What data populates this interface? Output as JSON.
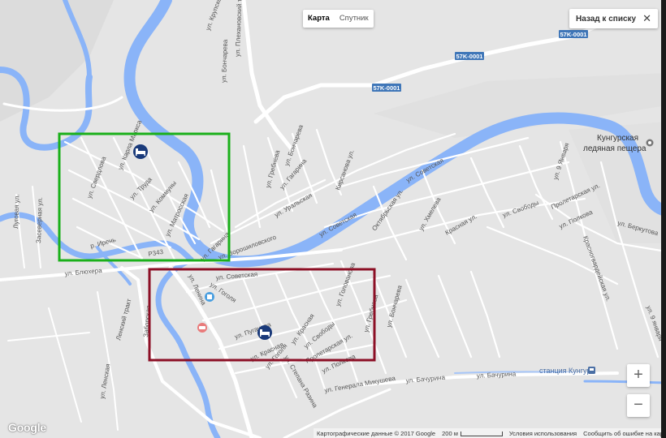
{
  "map_type": {
    "map": "Карта",
    "satellite": "Спутник"
  },
  "back_button": {
    "label": "Назад к списку",
    "close": "✕"
  },
  "zoom": {
    "in": "+",
    "out": "−"
  },
  "logo": "Google",
  "footer": {
    "copyright": "Картографические данные © 2017 Google",
    "scale": "200 м",
    "terms": "Условия использования",
    "report": "Сообщить об ошибке на карте"
  },
  "highways": [
    "57K-0001",
    "57K-0001",
    "57K-0001"
  ],
  "places": {
    "cave_line1": "Кунгурская",
    "cave_line2": "ледяная пещера",
    "station": "станция Кунгур"
  },
  "streets": {
    "krupskaya": "ул. Крупской",
    "plekhanov": "ул. Плехановский тракт",
    "bonchareva_top": "ул. Бончарева",
    "karl_marx": "ул. Карла Маркса",
    "sverdlova": "ул. Свердлова",
    "truda": "ул. Труда",
    "kommuny": "ул. Коммуны",
    "matrosskaya": "ул. Матросская",
    "gagarina_left": "ул. Гагарина",
    "gagarina_mid": "ул. Гагарина",
    "grebneva": "ул. Гребнева",
    "bonchareva_mid": "ул. Бончарева",
    "kirsanova": "Кирсанова ул.",
    "uralskaya": "ул. Уральская",
    "sovetskaya_top": "ул. Советская",
    "sovetskaya_mid": "ул. Советская",
    "sovetskaya_bottom": "ул. Советская",
    "voroshilovsky": "ул. Ворошиловского",
    "oktyabrskaya": "Октябрьская ул.",
    "khmeleva": "ул. Хмелева",
    "krasnaya_right": "Красная ул.",
    "svobody_right": "ул. Свободы",
    "proletarskaya_right": "Пролетарская ул.",
    "polkova": "ул. Полкова",
    "yanvarya_9_top": "ул. 9 Января",
    "yanvarya_9_bottom": "ул. 9 января",
    "berkutova": "ул. Беркутова",
    "krasnogvardeyskaya": "Красногвардейская ул.",
    "lugovaya": "Луговая ул.",
    "zaseverka": "Засеверная ул.",
    "blyukhera": "ул. Блюхера",
    "iren_river": "р. Ирень",
    "lenskiy_trakt": "Ленский тракт",
    "lenskaya": "ул. Ленская",
    "zaborskaya": "Заборская",
    "lenina": "ул. Ленина",
    "gogolya_top": "ул. Гоголя",
    "gogolya_bottom": "ул. Гоголя",
    "pugacheva": "ул. Пугачева",
    "krasnaya_bottom": "ул. Красная",
    "krasnaya_mid": "ул. Красная",
    "svobody_bottom": "ул. Свободы",
    "golovanova": "ул. Голованова",
    "proletarskaya_bottom": "Пролетарская ул.",
    "polkova_bottom": "ул. Полкова",
    "gen_mikusheva": "ул. Генерала Микушева",
    "bachurina_left": "ул. Бачурина",
    "bachurina_right": "ул. Бачурина",
    "bonchareva_bottom": "ул. Бончарева",
    "grebneva_bottom": "ул. Гребнева",
    "stepana_razina": "ул. Степана Разина",
    "r343": "Р343"
  },
  "colors": {
    "water": "#8ab4f8",
    "land": "#e8e8e8",
    "road": "#ffffff",
    "highway_badge": "#3f76b8",
    "green_box": "#1ab01a",
    "red_box": "#8c0f25",
    "marker": "#1a3a7a"
  }
}
